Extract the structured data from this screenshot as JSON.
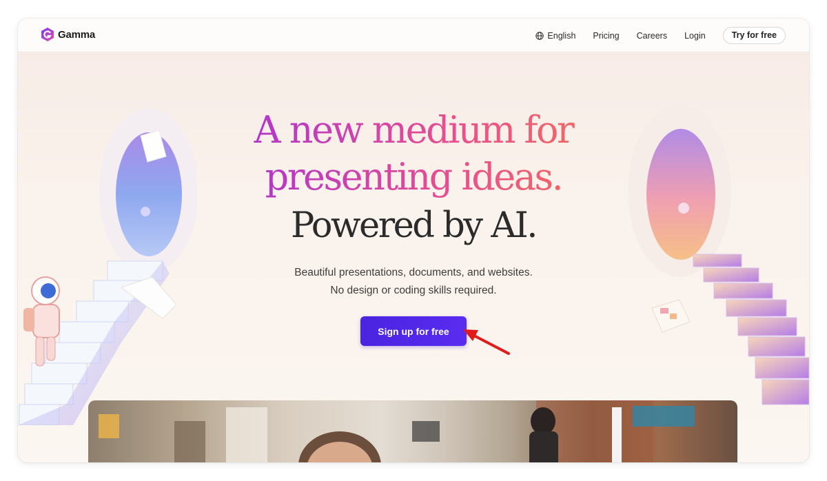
{
  "nav": {
    "brand": "Gamma",
    "language": "English",
    "links": [
      "Pricing",
      "Careers",
      "Login"
    ],
    "cta": "Try for free"
  },
  "hero": {
    "line1": "A new medium for",
    "line2": "presenting ideas.",
    "line3": "Powered by AI.",
    "sub1": "Beautiful presentations, documents, and websites.",
    "sub2": "No design or coding skills required.",
    "cta": "Sign up for free"
  },
  "colors": {
    "brand_purple": "#4a24e0",
    "gradient_start": "#6b2ad9",
    "gradient_end": "#f5934a",
    "annotation_arrow": "#e11b1b"
  },
  "icons": {
    "logo": "gamma-logo-icon",
    "language": "globe-icon",
    "annotation": "red-arrow-icon"
  }
}
